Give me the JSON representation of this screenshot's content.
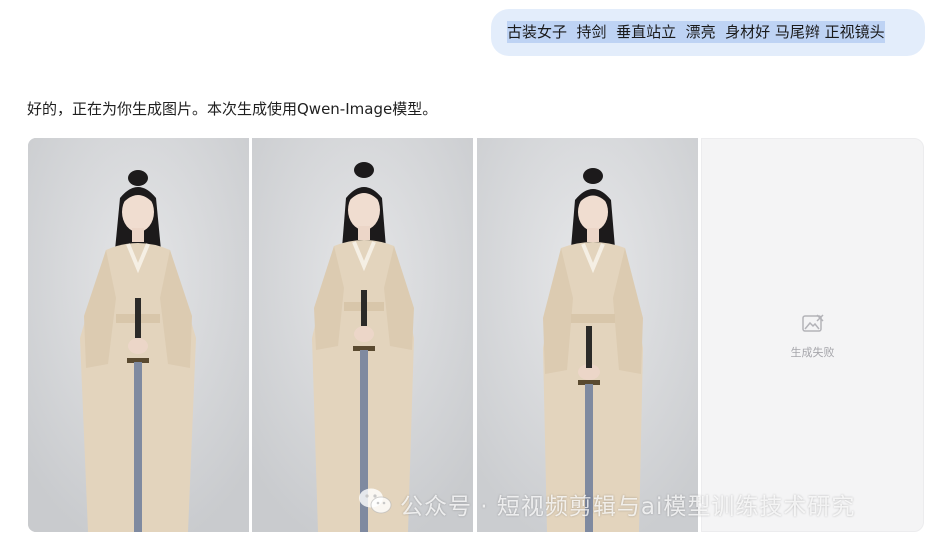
{
  "chat": {
    "user_message": "古装女子  持剑  垂直站立  漂亮  身材好 马尾辫 正视镜头",
    "assistant_reply": "好的，正在为你生成图片。本次生成使用Qwen-Image模型。"
  },
  "gallery": {
    "failed_label": "生成失败"
  },
  "watermark": {
    "text": "公众号 · 短视频剪辑与ai模型训练技术研究"
  },
  "colors": {
    "user_bubble": "#e3edfb",
    "selection_highlight": "#bed3f4",
    "robe": "#e3d4bd",
    "background_studio": "#d3d5d7"
  }
}
